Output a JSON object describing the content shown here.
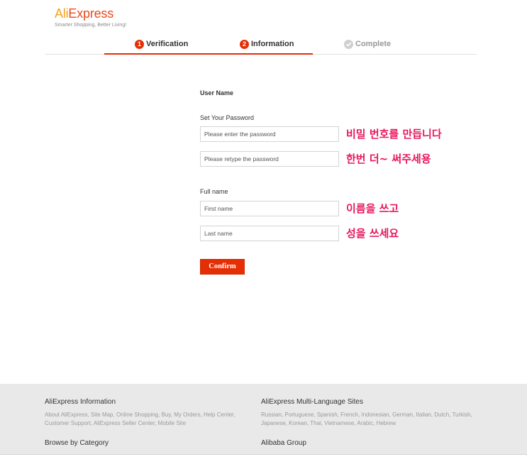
{
  "logo": {
    "ali": "Ali",
    "express": "Express",
    "tagline": "Smarter Shopping, Better Living!"
  },
  "steps": [
    {
      "number": "1",
      "label": "Verification",
      "status": "done"
    },
    {
      "number": "2",
      "label": "Information",
      "status": "current"
    },
    {
      "icon": "check-icon",
      "label": "Complete",
      "status": "upcoming"
    }
  ],
  "form": {
    "username_label": "User Name",
    "password_label": "Set Your Password",
    "password_placeholder": "Please enter the password",
    "password_value": "",
    "retype_placeholder": "Please retype the password",
    "retype_value": "",
    "fullname_label": "Full name",
    "first_name_placeholder": "First name",
    "first_name_value": "",
    "last_name_placeholder": "Last name",
    "last_name_value": "",
    "confirm_label": "Confirm"
  },
  "annotations": {
    "password": "비밀 번호를 만듭니다",
    "retype": "한번 더~ 써주세용",
    "first_name": "이름을 쓰고",
    "last_name": "성을 쓰세요"
  },
  "footer": {
    "link_separator": ", ",
    "aliexpress_info": {
      "title": "AliExpress Information",
      "link_lines": [
        [
          "About AliExpress",
          "Site Map",
          "Online Shopping",
          "Buy",
          "My Orders",
          "Help Center"
        ],
        [
          "Customer Support",
          "AliExpress Seller Center",
          "Mobile Site"
        ]
      ]
    },
    "multi_language": {
      "title": "AliExpress Multi-Language Sites",
      "link_lines": [
        [
          "Russian",
          "Portuguese",
          "Spanish",
          "French",
          "Indonesian",
          "German",
          "Italian",
          "Dutch",
          "Turkish"
        ],
        [
          "Japanese",
          "Korean",
          "Thai",
          "Vietnamese",
          "Arabic",
          "Hebrew"
        ]
      ]
    },
    "browse_by_category": {
      "title": "Browse by Category"
    },
    "alibaba_group": {
      "title": "Alibaba Group"
    }
  },
  "colors": {
    "accent": "#e62e04",
    "annotation": "#e8175d",
    "logo_ali": "#f5a11c",
    "logo_express": "#e8491d",
    "footer_bg": "#e9e9e9",
    "inactive_step": "#cfcfcf"
  }
}
